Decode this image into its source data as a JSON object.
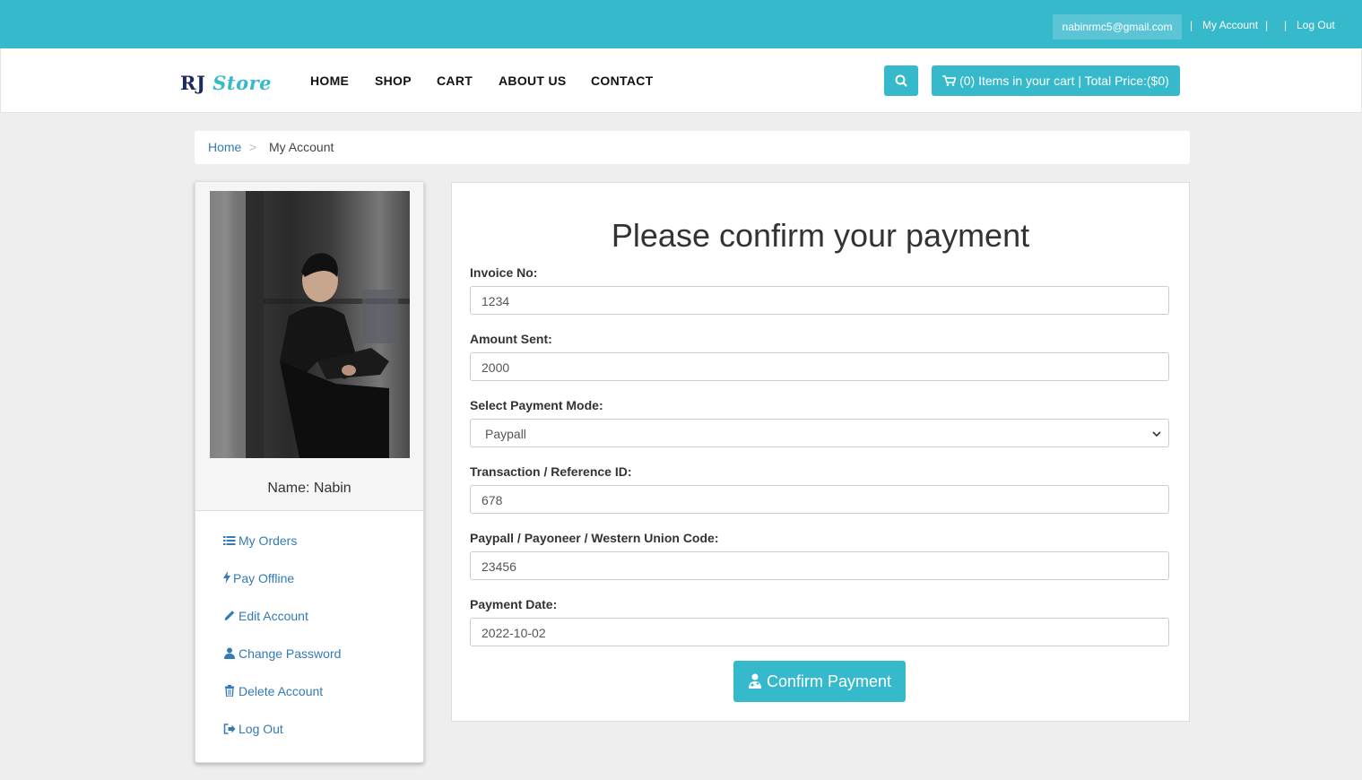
{
  "topbar": {
    "email": "nabinrmc5@gmail.com",
    "separator": "|",
    "my_account": "My Account",
    "log_out": "Log Out"
  },
  "brand": {
    "logo_part1": "RJ",
    "logo_part2": "Store",
    "accent_color": "#35b9cb"
  },
  "nav": {
    "items": [
      "HOME",
      "SHOP",
      "CART",
      "ABOUT US",
      "CONTACT"
    ],
    "cart_summary": "(0) Items in your cart | Total Price:($0)"
  },
  "breadcrumb": {
    "home": "Home",
    "separator": ">",
    "current": "My Account"
  },
  "sidebar": {
    "name": "Name: Nabin",
    "menu": [
      {
        "label": "My Orders",
        "icon": "list-icon"
      },
      {
        "label": "Pay Offline",
        "icon": "bolt-icon"
      },
      {
        "label": "Edit Account",
        "icon": "pencil-icon"
      },
      {
        "label": "Change Password",
        "icon": "user-icon"
      },
      {
        "label": "Delete Account",
        "icon": "trash-icon"
      },
      {
        "label": "Log Out",
        "icon": "sign-out-icon"
      }
    ]
  },
  "form": {
    "title": "Please confirm your payment",
    "invoice_label": "Invoice No:",
    "invoice_value": "1234",
    "amount_label": "Amount Sent:",
    "amount_value": "2000",
    "mode_label": "Select Payment Mode:",
    "mode_value": "Paypall",
    "txn_label": "Transaction / Reference ID:",
    "txn_value": "678",
    "code_label": "Paypall / Payoneer / Western Union Code:",
    "code_value": "23456",
    "date_label": "Payment Date:",
    "date_value": "2022-10-02",
    "submit_label": "Confirm Payment"
  }
}
